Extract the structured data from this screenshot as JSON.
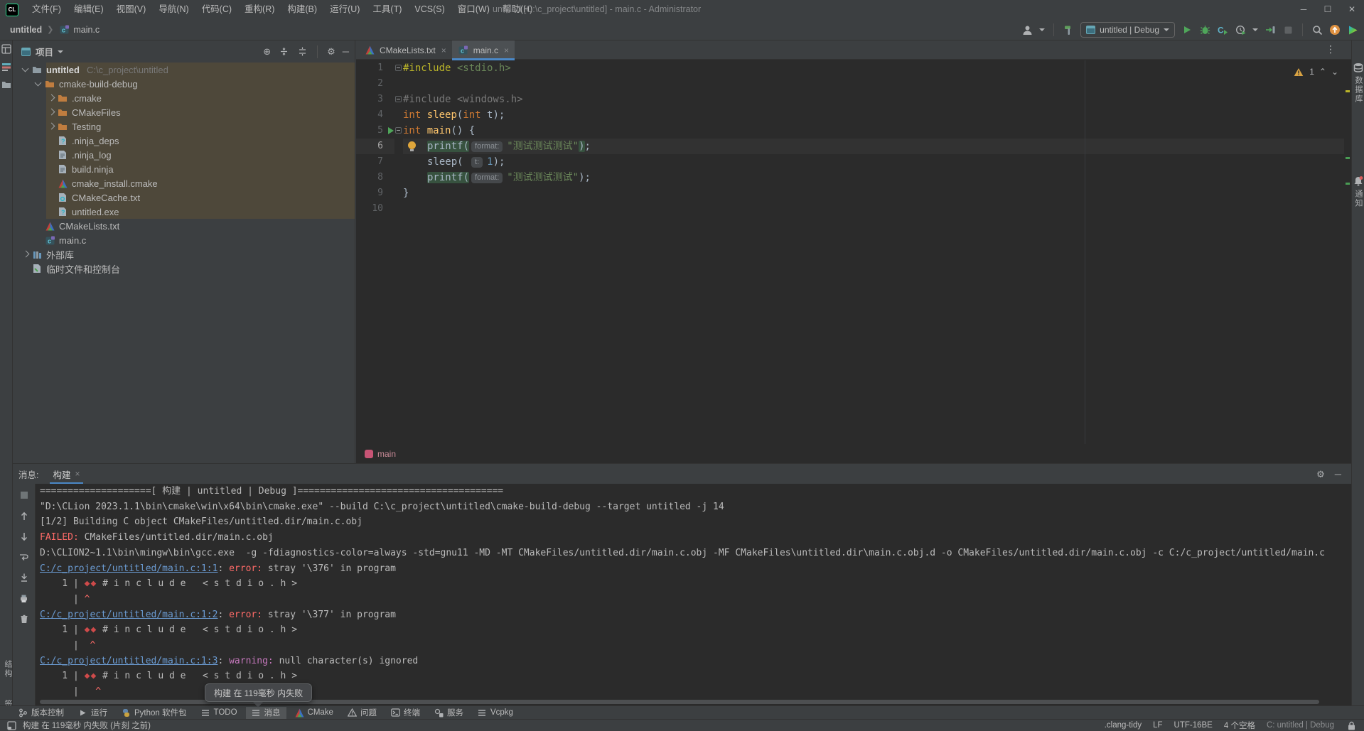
{
  "window": {
    "title": "untitled [C:\\c_project\\untitled] - main.c - Administrator"
  },
  "menubar": {
    "logo": "CL",
    "menus": [
      "文件(F)",
      "编辑(E)",
      "视图(V)",
      "导航(N)",
      "代码(C)",
      "重构(R)",
      "构建(B)",
      "运行(U)",
      "工具(T)",
      "VCS(S)",
      "窗口(W)",
      "帮助(H)"
    ]
  },
  "navbar": {
    "breadcrumbs": [
      "untitled",
      "main.c"
    ],
    "run_config": "untitled | Debug"
  },
  "left_stripe": {
    "bottom_labels": [
      "结构",
      "书签"
    ]
  },
  "right_stripe": {
    "items": [
      {
        "icon": "db",
        "label": "数据库"
      },
      {
        "icon": "bell",
        "label": "通知"
      }
    ]
  },
  "project": {
    "header": "项目",
    "tree": [
      {
        "label": "untitled",
        "path": "C:\\c_project\\untitled",
        "icon": "folder",
        "depth": 0,
        "chev": "d",
        "hl": true,
        "bold": true
      },
      {
        "label": "cmake-build-debug",
        "icon": "foldero",
        "depth": 1,
        "chev": "d",
        "hl": true
      },
      {
        "label": ".cmake",
        "icon": "foldero",
        "depth": 2,
        "chev": "r",
        "hl": true
      },
      {
        "label": "CMakeFiles",
        "icon": "foldero",
        "depth": 2,
        "chev": "r",
        "hl": true
      },
      {
        "label": "Testing",
        "icon": "foldero",
        "depth": 2,
        "chev": "r",
        "hl": true
      },
      {
        "label": ".ninja_deps",
        "icon": "fileq",
        "depth": 2,
        "hl": true
      },
      {
        "label": ".ninja_log",
        "icon": "filetxt",
        "depth": 2,
        "hl": true
      },
      {
        "label": "build.ninja",
        "icon": "filetxt",
        "depth": 2,
        "hl": true
      },
      {
        "label": "cmake_install.cmake",
        "icon": "cmake",
        "depth": 2,
        "hl": true
      },
      {
        "label": "CMakeCache.txt",
        "icon": "filegear",
        "depth": 2,
        "hl": true
      },
      {
        "label": "untitled.exe",
        "icon": "fileq",
        "depth": 2,
        "hl": true
      },
      {
        "label": "CMakeLists.txt",
        "icon": "cmake",
        "depth": 1,
        "hl": false
      },
      {
        "label": "main.c",
        "icon": "cfile",
        "depth": 1,
        "hl": false
      },
      {
        "label": "外部库",
        "icon": "lib",
        "depth": 0,
        "chev": "r",
        "hl": false
      },
      {
        "label": "临时文件和控制台",
        "icon": "scratch",
        "depth": 0,
        "hl": false
      }
    ]
  },
  "editor": {
    "tabs": [
      {
        "label": "CMakeLists.txt",
        "icon": "cmake",
        "active": false
      },
      {
        "label": "main.c",
        "icon": "cfile",
        "active": true
      }
    ],
    "inspections": {
      "warning_count": "1"
    },
    "breadcrumb": {
      "label": "main"
    },
    "lines": [
      {
        "num": "1",
        "fold": true,
        "segs": [
          {
            "c": "dir",
            "t": "#include"
          },
          {
            "c": "pl",
            "t": " "
          },
          {
            "c": "str",
            "t": "<stdio.h>"
          }
        ]
      },
      {
        "num": "2",
        "segs": []
      },
      {
        "num": "3",
        "fold": true,
        "segs": [
          {
            "c": "dim",
            "t": "#include <windows.h>"
          }
        ]
      },
      {
        "num": "4",
        "segs": [
          {
            "c": "kw",
            "t": "int"
          },
          {
            "c": "pl",
            "t": " "
          },
          {
            "c": "fn",
            "t": "sleep"
          },
          {
            "c": "pl",
            "t": "("
          },
          {
            "c": "kw",
            "t": "int"
          },
          {
            "c": "pl",
            "t": " t);"
          }
        ]
      },
      {
        "num": "5",
        "fold": true,
        "run": true,
        "segs": [
          {
            "c": "kw",
            "t": "int"
          },
          {
            "c": "pl",
            "t": " "
          },
          {
            "c": "fn",
            "t": "main"
          },
          {
            "c": "pl",
            "t": "() {"
          }
        ]
      },
      {
        "num": "6",
        "cur": true,
        "bulb": true,
        "ind": true,
        "segs": [
          {
            "c": "pl",
            "h": true,
            "t": "printf("
          },
          {
            "c": "inlay",
            "t": "format:"
          },
          {
            "c": "str",
            "t": "\"测试测试测试\""
          },
          {
            "c": "pl",
            "h": true,
            "t": ")"
          },
          {
            "c": "pl",
            "t": ";"
          }
        ]
      },
      {
        "num": "7",
        "ind": true,
        "segs": [
          {
            "c": "pl",
            "t": "sleep( "
          },
          {
            "c": "inlay",
            "t": "t:"
          },
          {
            "c": "num",
            "t": "1"
          },
          {
            "c": "pl",
            "t": ");"
          }
        ]
      },
      {
        "num": "8",
        "ind": true,
        "segs": [
          {
            "c": "pl",
            "h": true,
            "t": "printf("
          },
          {
            "c": "inlay",
            "t": "format:"
          },
          {
            "c": "str",
            "t": "\"测试测试测试\""
          },
          {
            "c": "pl",
            "t": ");"
          }
        ]
      },
      {
        "num": "9",
        "segs": [
          {
            "c": "pl",
            "t": "}"
          }
        ]
      },
      {
        "num": "10",
        "segs": []
      }
    ]
  },
  "messages": {
    "label": "消息:",
    "tab": "构建",
    "console": [
      [
        {
          "c": "pl",
          "t": "====================[ 构建 | untitled | Debug ]====================================="
        }
      ],
      [
        {
          "c": "pl",
          "t": "\"D:\\CLion 2023.1.1\\bin\\cmake\\win\\x64\\bin\\cmake.exe\" --build C:\\c_project\\untitled\\cmake-build-debug --target untitled -j 14"
        }
      ],
      [
        {
          "c": "pl",
          "t": "[1/2] Building C object CMakeFiles/untitled.dir/main.c.obj"
        }
      ],
      [
        {
          "c": "red",
          "t": "FAILED: "
        },
        {
          "c": "pl",
          "t": "CMakeFiles/untitled.dir/main.c.obj"
        }
      ],
      [
        {
          "c": "pl",
          "t": "D:\\CLION2~1.1\\bin\\mingw\\bin\\gcc.exe  -g -fdiagnostics-color=always -std=gnu11 -MD -MT CMakeFiles/untitled.dir/main.c.obj -MF CMakeFiles\\untitled.dir\\main.c.obj.d -o CMakeFiles/untitled.dir/main.c.obj -c C:/c_project/untitled/main.c"
        }
      ],
      [
        {
          "c": "link",
          "t": "C:/c_project/untitled/main.c:1:1"
        },
        {
          "c": "pl",
          "t": ": "
        },
        {
          "c": "err",
          "t": "error: "
        },
        {
          "c": "pl",
          "t": "stray '\\376' in program"
        }
      ],
      [
        {
          "c": "pl",
          "t": "    1 | "
        },
        {
          "c": "dia",
          "t": "◆◆"
        },
        {
          "c": "pl",
          "t": " # i n c l u d e   < s t d i o . h >"
        }
      ],
      [
        {
          "c": "pl",
          "t": "      | "
        },
        {
          "c": "caret",
          "t": "^"
        }
      ],
      [
        {
          "c": "link",
          "t": "C:/c_project/untitled/main.c:1:2"
        },
        {
          "c": "pl",
          "t": ": "
        },
        {
          "c": "err",
          "t": "error: "
        },
        {
          "c": "pl",
          "t": "stray '\\377' in program"
        }
      ],
      [
        {
          "c": "pl",
          "t": "    1 | "
        },
        {
          "c": "dia",
          "t": "◆◆"
        },
        {
          "c": "pl",
          "t": " # i n c l u d e   < s t d i o . h >"
        }
      ],
      [
        {
          "c": "pl",
          "t": "      |  "
        },
        {
          "c": "caret",
          "t": "^"
        }
      ],
      [
        {
          "c": "link",
          "t": "C:/c_project/untitled/main.c:1:3"
        },
        {
          "c": "pl",
          "t": ": "
        },
        {
          "c": "warn",
          "t": "warning: "
        },
        {
          "c": "pl",
          "t": "null character(s) ignored"
        }
      ],
      [
        {
          "c": "pl",
          "t": "    1 | "
        },
        {
          "c": "dia",
          "t": "◆◆"
        },
        {
          "c": "pl",
          "t": " # i n c l u d e   < s t d i o . h >"
        }
      ],
      [
        {
          "c": "pl",
          "t": "      |   "
        },
        {
          "c": "caret",
          "t": "^"
        }
      ]
    ]
  },
  "balloon": {
    "text": "构建 在 119毫秒 内失败"
  },
  "tool_buttons": [
    {
      "icon": "branch",
      "label": "版本控制"
    },
    {
      "icon": "play",
      "label": "运行"
    },
    {
      "icon": "python",
      "label": "Python 软件包"
    },
    {
      "icon": "list",
      "label": "TODO"
    },
    {
      "icon": "list",
      "label": "消息",
      "active": true
    },
    {
      "icon": "cmake",
      "label": "CMake"
    },
    {
      "icon": "problem",
      "label": "问题"
    },
    {
      "icon": "terminal",
      "label": "终端"
    },
    {
      "icon": "services",
      "label": "服务"
    },
    {
      "icon": "list",
      "label": "Vcpkg"
    }
  ],
  "statusbar": {
    "left": "构建 在 119毫秒 内失败 (片刻 之前)",
    "right": [
      ".clang-tidy",
      "LF",
      "UTF-16BE",
      "4 个空格"
    ],
    "right_dim": "C: untitled | Debug"
  }
}
